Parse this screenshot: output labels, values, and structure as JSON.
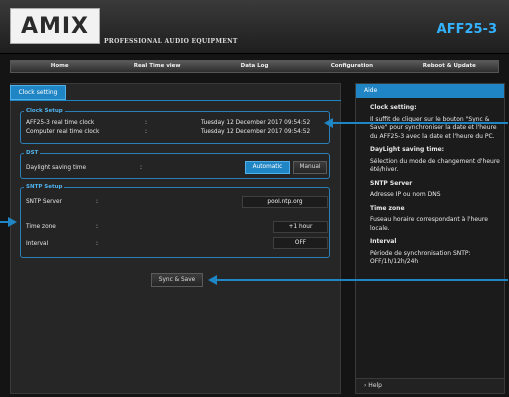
{
  "header": {
    "logo": "AMIX",
    "subtitle": "PROFESSIONAL AUDIO EQUIPMENT",
    "model": "AFF25-3"
  },
  "menu": [
    "Home",
    "Real Time view",
    "Data Log",
    "Configuration",
    "Reboot & Update"
  ],
  "tab": "Clock setting",
  "clock_setup": {
    "legend": "Clock Setup",
    "rows": [
      {
        "label": "AFF25-3 real time clock",
        "sep": ":",
        "value": "Tuesday 12 December 2017 09:54:52"
      },
      {
        "label": "Computer real time clock",
        "sep": ":",
        "value": "Tuesday 12 December 2017 09:54:52"
      }
    ]
  },
  "dst": {
    "legend": "DST",
    "label": "Daylight saving time",
    "sep": ":",
    "automatic": "Automatic",
    "manual": "Manual"
  },
  "sntp": {
    "legend": "SNTP Setup",
    "server_label": "SNTP Server",
    "server_value": "pool.ntp.org",
    "tz_label": "Time zone",
    "tz_value": "+1 hour",
    "interval_label": "Interval",
    "interval_value": "OFF",
    "sep": ":"
  },
  "sync_button": "Sync & Save",
  "aide": {
    "title": "Aide",
    "sections": [
      {
        "heading": "Clock setting:",
        "text": "Il suffit de cliquer sur le bouton \"Sync & Save\" pour synchroniser la date et l'heure du AFF25-3 avec la date et l'heure du PC."
      },
      {
        "heading": "DayLight saving time:",
        "text": "Sélection du mode de changement d'heure été/hiver."
      },
      {
        "heading": "SNTP Server",
        "text": "Adresse IP ou nom DNS"
      },
      {
        "heading": "Time zone",
        "text": "Fuseau horaire correspondant à l'heure locale."
      },
      {
        "heading": "Interval",
        "text": "Période de synchronisation SNTP: OFF/1h/12h/24h"
      }
    ],
    "footer": "› Help"
  },
  "colors": {
    "accent": "#1f85c4",
    "model": "#33b2ff",
    "legend": "#4fb3ee"
  }
}
